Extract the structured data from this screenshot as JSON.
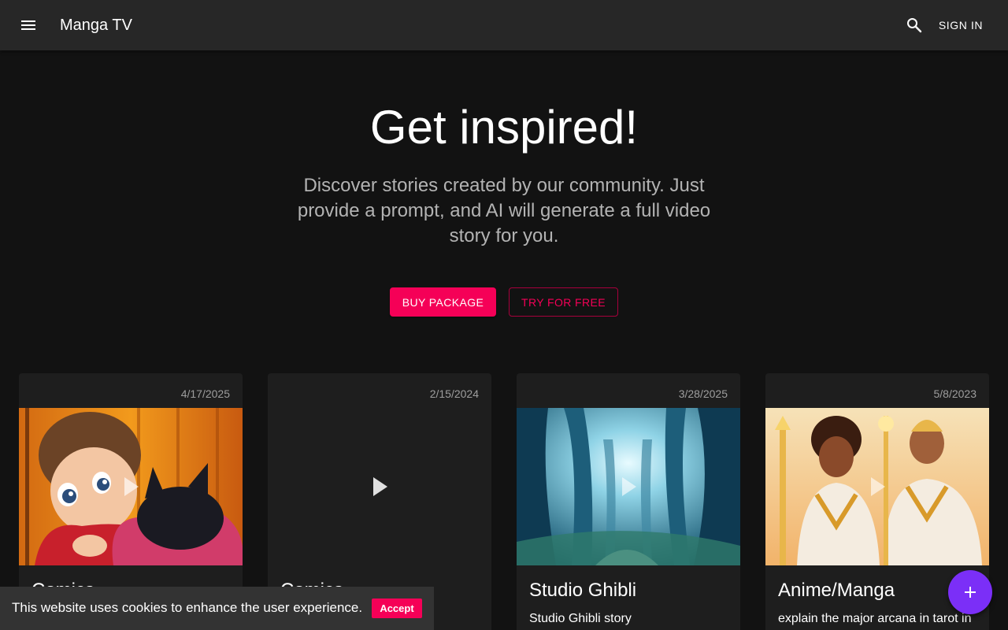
{
  "appbar": {
    "brand": "Manga TV",
    "signin_label": "SIGN IN",
    "menu_icon": "menu-icon",
    "search_icon": "search-icon"
  },
  "hero": {
    "title": "Get inspired!",
    "subtitle": "Discover stories created by our community. Just provide a prompt, and AI will generate a full video story for you.",
    "buy_label": "BUY PACKAGE",
    "try_label": "TRY FOR FREE"
  },
  "cards": [
    {
      "date": "4/17/2025",
      "title": "Comics",
      "description": ""
    },
    {
      "date": "2/15/2024",
      "title": "Comics",
      "description": ""
    },
    {
      "date": "3/28/2025",
      "title": "Studio Ghibli",
      "description": "Studio Ghibli story"
    },
    {
      "date": "5/8/2023",
      "title": "Anime/Manga",
      "description": "explain the major arcana in tarot in"
    }
  ],
  "cookie": {
    "text": "This website uses cookies to enhance the user experience.",
    "accept_label": "Accept"
  },
  "fab": {
    "icon": "plus-icon"
  },
  "colors": {
    "accent": "#f50057",
    "fab": "#7b2ff7",
    "appbar": "#272727",
    "background": "#121212"
  }
}
